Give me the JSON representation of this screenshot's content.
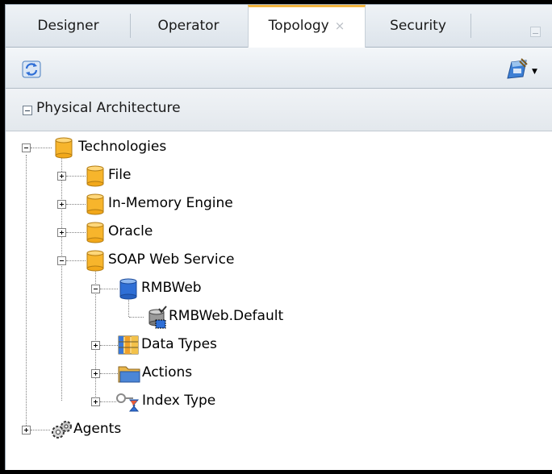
{
  "tabs": [
    {
      "label": "Designer",
      "active": false
    },
    {
      "label": "Operator",
      "active": false
    },
    {
      "label": "Topology",
      "active": true,
      "close": "×"
    },
    {
      "label": "Security",
      "active": false
    }
  ],
  "section": {
    "title": "Physical Architecture"
  },
  "tree": {
    "technologies": "Technologies",
    "file": "File",
    "in_memory": "In-Memory Engine",
    "oracle": "Oracle",
    "soap": "SOAP Web Service",
    "rmbweb": "RMBWeb",
    "rmbweb_default": "RMBWeb.Default",
    "data_types": "Data Types",
    "actions": "Actions",
    "index_type": "Index Type",
    "agents": "Agents"
  },
  "colors": {
    "active_tab_accent": "#f4b640",
    "tech_cylinder": "#f7b52c",
    "schema_cylinder": "#2f6fd6"
  }
}
